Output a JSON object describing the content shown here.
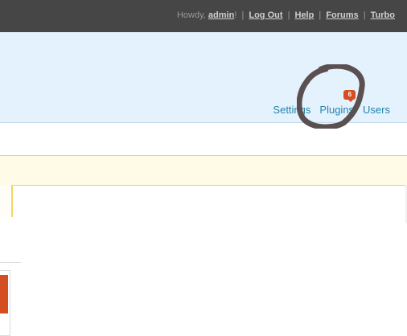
{
  "topbar": {
    "greeting": "Howdy,",
    "user": "admin",
    "user_suffix": "!",
    "links": [
      "Log Out",
      "Help",
      "Forums",
      "Turbo"
    ]
  },
  "nav": {
    "items": [
      "Settings",
      "Plugins",
      "Users"
    ],
    "plugins_badge": "6"
  },
  "colors": {
    "topbar": "#464646",
    "header": "#e4f2fd",
    "link": "#2583ad",
    "badge": "#d54e21",
    "notice": "#fffbe6",
    "annotation": "#5a5050"
  }
}
